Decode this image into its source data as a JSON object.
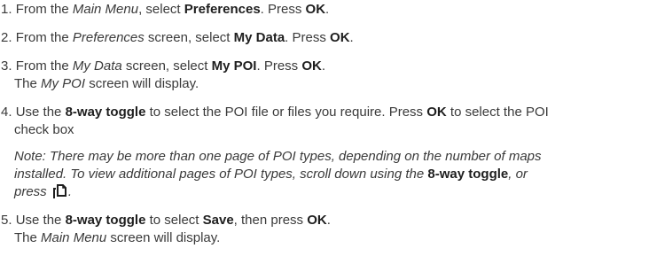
{
  "steps": [
    {
      "num": "1.",
      "line1": {
        "a": "From the ",
        "b_em": "Main Menu",
        "c": ", select ",
        "d_bold": "Preferences",
        "e": ". Press ",
        "f_bold": "OK",
        "g": "."
      }
    },
    {
      "num": "2.",
      "line1": {
        "a": "From the ",
        "b_em": "Preferences",
        "c": " screen, select ",
        "d_bold": "My Data",
        "e": ". Press ",
        "f_bold": "OK",
        "g": "."
      }
    },
    {
      "num": "3.",
      "line1": {
        "a": "From the ",
        "b_em": "My Data",
        "c": " screen, select ",
        "d_bold": "My POI",
        "e": ". Press ",
        "f_bold": "OK",
        "g": "."
      },
      "line2": {
        "a": "The ",
        "b_em": "My POI",
        "c": " screen will display."
      }
    },
    {
      "num": "4.",
      "line1": {
        "a": "Use the ",
        "b_bold": "8-way toggle",
        "c": " to select the POI file or files you require. Press ",
        "d_bold": "OK",
        "e": " to select the POI"
      },
      "line2": {
        "a": "check box"
      },
      "note": {
        "line1": "Note: There may be more than one page of POI types, depending on the number of maps",
        "line2_a": "installed. To view additional pages of POI types, scroll down using the ",
        "line2_b_bold": "8-way toggle",
        "line2_c": ", or",
        "line3": "press",
        "icon": "page-scroll-icon"
      }
    },
    {
      "num": "5.",
      "line1": {
        "a": "Use the ",
        "b_bold": "8-way toggle",
        "c": " to select ",
        "d_bold": "Save",
        "e": ", then press ",
        "f_bold": "OK",
        "g": "."
      },
      "line2": {
        "a": "The ",
        "b_em": "Main Menu",
        "c": " screen will display."
      }
    }
  ]
}
